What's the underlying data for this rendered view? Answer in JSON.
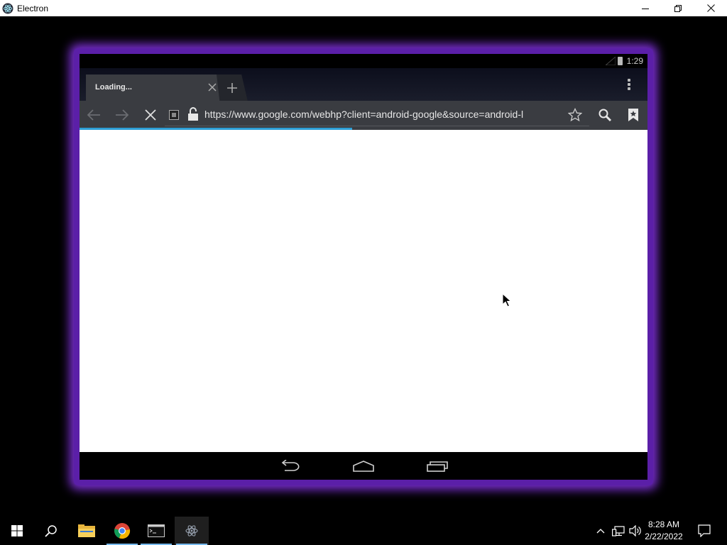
{
  "window": {
    "title": "Electron"
  },
  "android": {
    "status_time": "1:29",
    "browser": {
      "tab_title": "Loading...",
      "url": "https://www.google.com/webhp?client=android-google&source=android-l",
      "load_progress": 0.48
    }
  },
  "taskbar": {
    "time": "8:28 AM",
    "date": "2/22/2022"
  },
  "colors": {
    "emulator_glow": "#7a2fd0",
    "progress": "#2e9fd6",
    "taskbar_indicator": "#76b9ed"
  }
}
